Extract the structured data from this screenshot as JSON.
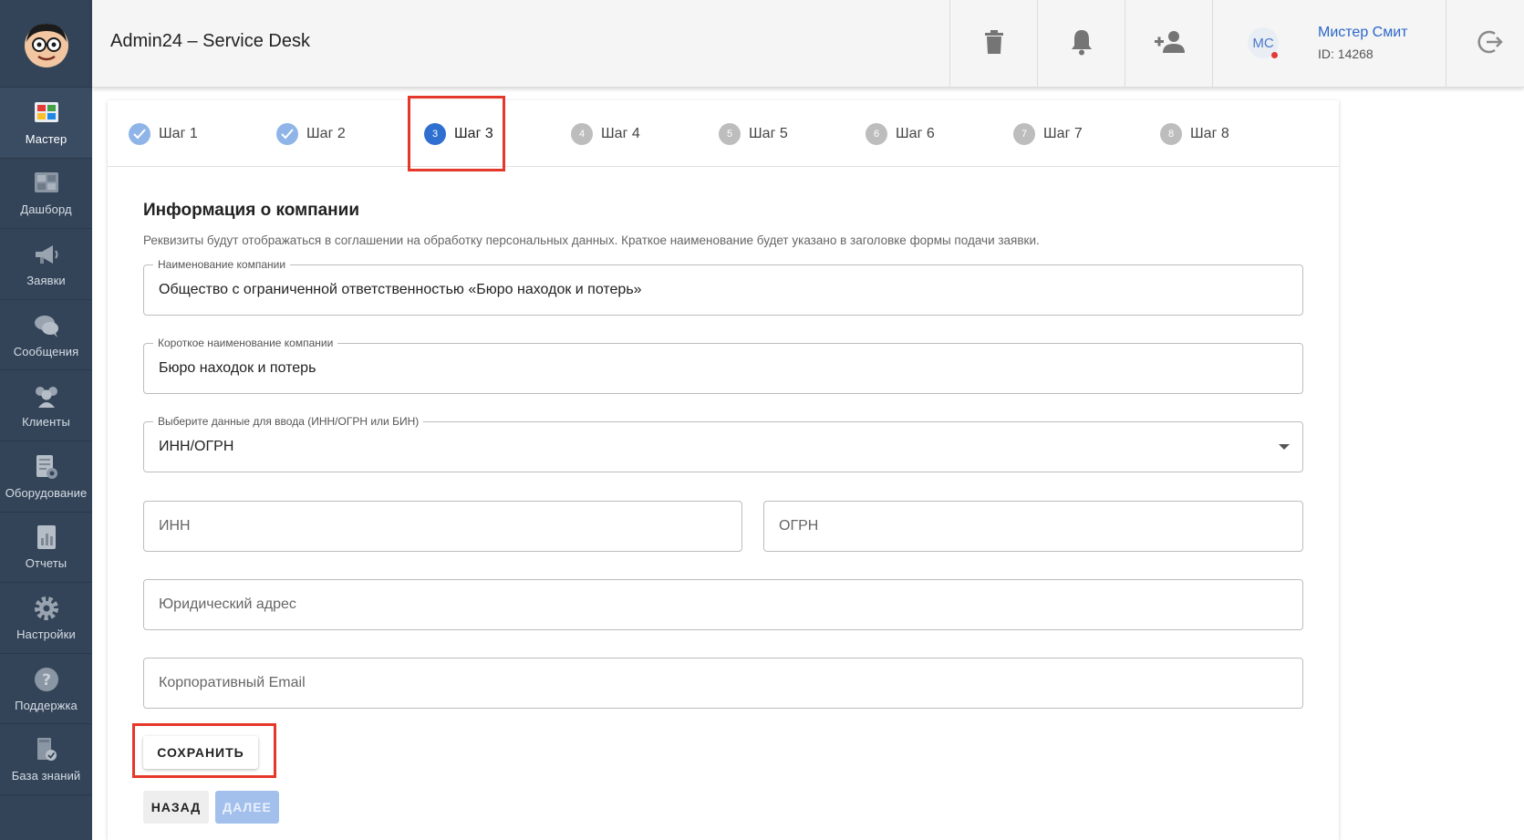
{
  "app": {
    "title": "Admin24 – Service Desk"
  },
  "sidebar": {
    "items": [
      {
        "label": "Мастер",
        "icon": "wizard-icon",
        "active": true
      },
      {
        "label": "Дашборд",
        "icon": "dashboard-icon",
        "active": false
      },
      {
        "label": "Заявки",
        "icon": "megaphone-icon",
        "active": false
      },
      {
        "label": "Сообщения",
        "icon": "chat-icon",
        "active": false
      },
      {
        "label": "Клиенты",
        "icon": "clients-icon",
        "active": false
      },
      {
        "label": "Оборудование",
        "icon": "equipment-icon",
        "active": false
      },
      {
        "label": "Отчеты",
        "icon": "reports-icon",
        "active": false
      },
      {
        "label": "Настройки",
        "icon": "gear-icon",
        "active": false
      },
      {
        "label": "Поддержка",
        "icon": "help-icon",
        "active": false
      },
      {
        "label": "База знаний",
        "icon": "knowledge-base-icon",
        "active": false
      }
    ]
  },
  "header": {
    "user": {
      "initials": "МС",
      "name": "Мистер Смит",
      "id_text": "ID: 14268"
    },
    "icons": [
      "trash-icon",
      "bell-icon",
      "add-user-icon",
      "logout-icon"
    ]
  },
  "stepper": {
    "steps": [
      {
        "label": "Шаг 1",
        "num": "1",
        "state": "done"
      },
      {
        "label": "Шаг 2",
        "num": "2",
        "state": "done"
      },
      {
        "label": "Шаг 3",
        "num": "3",
        "state": "current"
      },
      {
        "label": "Шаг 4",
        "num": "4",
        "state": "todo"
      },
      {
        "label": "Шаг 5",
        "num": "5",
        "state": "todo"
      },
      {
        "label": "Шаг 6",
        "num": "6",
        "state": "todo"
      },
      {
        "label": "Шаг 7",
        "num": "7",
        "state": "todo"
      },
      {
        "label": "Шаг 8",
        "num": "8",
        "state": "todo"
      }
    ]
  },
  "form": {
    "title": "Информация о компании",
    "description": "Реквизиты будут отображаться в соглашении на обработку персональных данных. Краткое наименование будет указано в заголовке формы подачи заявки.",
    "company_name": {
      "label": "Наименование компании",
      "value": "Общество с ограниченной ответственностью  «Бюро находок и потерь»"
    },
    "short_name": {
      "label": "Короткое наименование компании",
      "value": "Бюро находок и потерь"
    },
    "id_type": {
      "label": "Выберите данные для ввода (ИНН/ОГРН или БИН)",
      "value": "ИНН/ОГРН"
    },
    "inn": {
      "placeholder": "ИНН"
    },
    "ogrn": {
      "placeholder": "ОГРН"
    },
    "legal_address": {
      "placeholder": "Юридический адрес"
    },
    "corp_email": {
      "placeholder": "Корпоративный Email"
    }
  },
  "buttons": {
    "save": "СОХРАНИТЬ",
    "back": "НАЗАД",
    "next": "ДАЛЕЕ"
  },
  "colors": {
    "sidebar": "#334458",
    "accent": "#2e6fd0",
    "highlight": "#e5382a",
    "user_name": "#2b67c7"
  }
}
